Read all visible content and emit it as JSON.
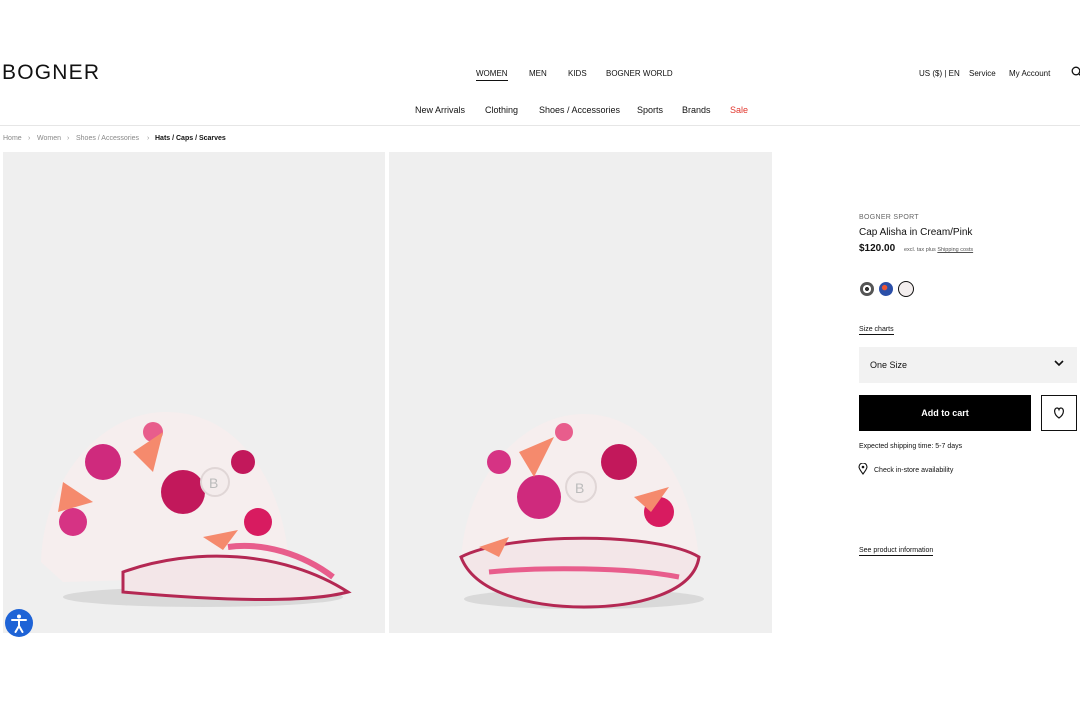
{
  "header": {
    "logo": "BOGNER",
    "primary_nav": [
      "WOMEN",
      "MEN",
      "KIDS",
      "BOGNER WORLD"
    ],
    "locale": "US ($) | EN",
    "service": "Service",
    "account": "My Account",
    "sub_nav": [
      "New Arrivals",
      "Clothing",
      "Shoes / Accessories",
      "Sports",
      "Brands",
      "Sale"
    ]
  },
  "breadcrumb": [
    "Home",
    "Women",
    "Shoes / Accessories",
    "Hats / Caps / Scarves"
  ],
  "product": {
    "brand": "BOGNER SPORT",
    "title": "Cap Alisha in Cream/Pink",
    "price": "$120.00",
    "tax_note": "excl. tax plus",
    "shipping_costs_link": "Shipping costs",
    "size_charts_link": "Size charts",
    "size_selected": "One Size",
    "add_to_cart": "Add to cart",
    "shipping_time": "Expected shipping time: 5-7 days",
    "store_availability": "Check in-store availability",
    "product_info_link": "See product information"
  },
  "colors": {
    "accent_sale": "#e2362d",
    "button_bg": "#000000",
    "image_bg": "#efefef",
    "accessibility_button": "#1e63d6"
  },
  "icons": [
    "search-icon",
    "chevron-down-icon",
    "heart-icon",
    "location-pin-icon",
    "accessibility-icon"
  ]
}
